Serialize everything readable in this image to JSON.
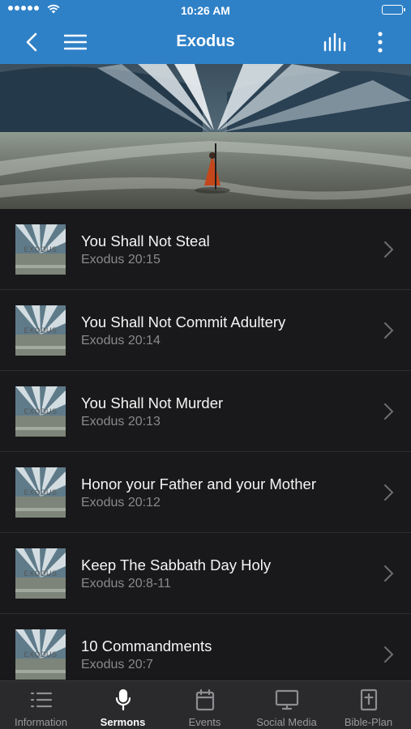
{
  "status": {
    "time": "10:26 AM"
  },
  "nav": {
    "title": "Exodus"
  },
  "sermons": [
    {
      "title": "You Shall Not Steal",
      "ref": "Exodus 20:15"
    },
    {
      "title": "You Shall Not Commit Adultery",
      "ref": "Exodus 20:14"
    },
    {
      "title": "You Shall Not Murder",
      "ref": "Exodus 20:13"
    },
    {
      "title": "Honor your Father and your Mother",
      "ref": "Exodus 20:12"
    },
    {
      "title": "Keep The Sabbath Day Holy",
      "ref": "Exodus 20:8-11"
    },
    {
      "title": "10 Commandments",
      "ref": "Exodus 20:7"
    }
  ],
  "thumb_caption": "EXODUS",
  "tabs": [
    {
      "label": "Information",
      "icon": "list-icon",
      "active": false
    },
    {
      "label": "Sermons",
      "icon": "microphone-icon",
      "active": true
    },
    {
      "label": "Events",
      "icon": "calendar-icon",
      "active": false
    },
    {
      "label": "Social Media",
      "icon": "monitor-icon",
      "active": false
    },
    {
      "label": "Bible-Plan",
      "icon": "bible-icon",
      "active": false
    }
  ],
  "colors": {
    "accent": "#2f81c7",
    "background": "#19191b",
    "tabbar": "#2a2a2c"
  }
}
